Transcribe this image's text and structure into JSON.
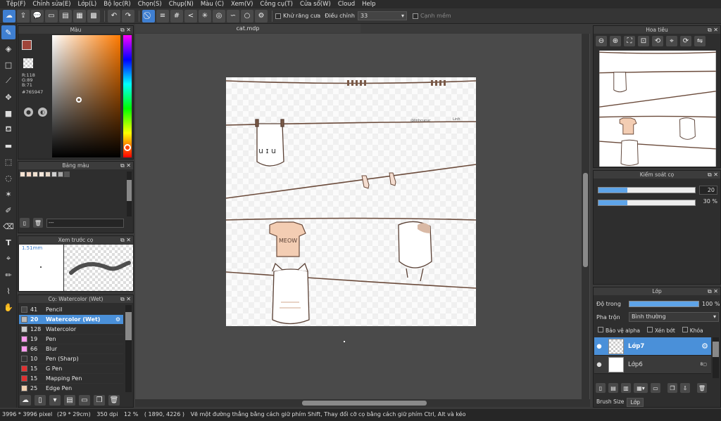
{
  "menu": [
    "Tệp(F)",
    "Chỉnh sửa(E)",
    "Lớp(L)",
    "Bộ lọc(R)",
    "Chọn(S)",
    "Chụp(N)",
    "Màu (C)",
    "Xem(V)",
    "Công cụ(T)",
    "Cửa sổ(W)",
    "Cloud",
    "Help"
  ],
  "toolbar": {
    "antialias_label": "Khử răng cưa",
    "adjust_label": "Điều chỉnh",
    "adjust_value": "33",
    "edge_label": "Cạnh mềm"
  },
  "color_panel": {
    "title": "Màu",
    "r": "R:118",
    "g": "G:89",
    "b": "B:71",
    "hex": "#765947",
    "main_color": "#a0453a"
  },
  "palette_panel": {
    "title": "Bảng màu",
    "swatches": [
      "#f8e4d4",
      "#f4d6c4",
      "#efe0d0",
      "#f6e8dc",
      "#e8d8c8",
      "#cfcfcf",
      "#aaaaaa",
      "#555555"
    ],
    "name_value": "---"
  },
  "preview_panel": {
    "title": "Xem trước cọ",
    "size": "1.51mm"
  },
  "brush_panel": {
    "title": "Cọ: Watercolor (Wet)",
    "items": [
      {
        "size": "41",
        "name": "Pencil",
        "color": "#444444"
      },
      {
        "size": "20",
        "name": "Watercolor (Wet)",
        "color": "#bbbbbb"
      },
      {
        "size": "128",
        "name": "Watercolor",
        "color": "#cccccc"
      },
      {
        "size": "19",
        "name": "Pen",
        "color": "#ff99ee"
      },
      {
        "size": "66",
        "name": "Blur",
        "color": "#ff99ee"
      },
      {
        "size": "10",
        "name": "Pen (Sharp)",
        "color": "#333333"
      },
      {
        "size": "15",
        "name": "G Pen",
        "color": "#e03030"
      },
      {
        "size": "15",
        "name": "Mapping Pen",
        "color": "#e03030"
      },
      {
        "size": "25",
        "name": "Edge Pen",
        "color": "#f0d0b0"
      }
    ]
  },
  "document": {
    "tab": "cat.mdp"
  },
  "canvas_text": {
    "signature": "@linhcucuc",
    "tag": "Linh",
    "shirt": "MEOW"
  },
  "navigator": {
    "title": "Hoa tiêu"
  },
  "brush_control": {
    "title": "Kiểm soát cọ",
    "size_value": "20",
    "opacity_value": "30 %",
    "size_fill": 0.3,
    "opacity_fill": 0.3
  },
  "layer_panel": {
    "title": "Lớp",
    "opacity_label": "Độ trong",
    "opacity_value": "100 %",
    "opacity_fill": 1.0,
    "blend_label": "Pha trộn",
    "blend_value": "Bình thường",
    "protect_alpha": "Bảo vệ alpha",
    "clip": "Xén bớt",
    "lock": "Khóa",
    "layers": [
      {
        "name": "Lớp7",
        "selected": true
      },
      {
        "name": "Lớp6",
        "selected": false
      }
    ]
  },
  "bottom_tabs": [
    "Brush Size",
    "Lớp"
  ],
  "status": {
    "dimensions": "3996 * 3996 pixel",
    "physical": "(29 * 29cm)",
    "dpi": "350 dpi",
    "zoom": "12 %",
    "coords": "( 1890, 4226 )",
    "hint": "Vẽ một đường thẳng bằng cách giữ phím Shift, Thay đổi cỡ cọ bằng cách giữ phím Ctrl, Alt và kéo"
  }
}
